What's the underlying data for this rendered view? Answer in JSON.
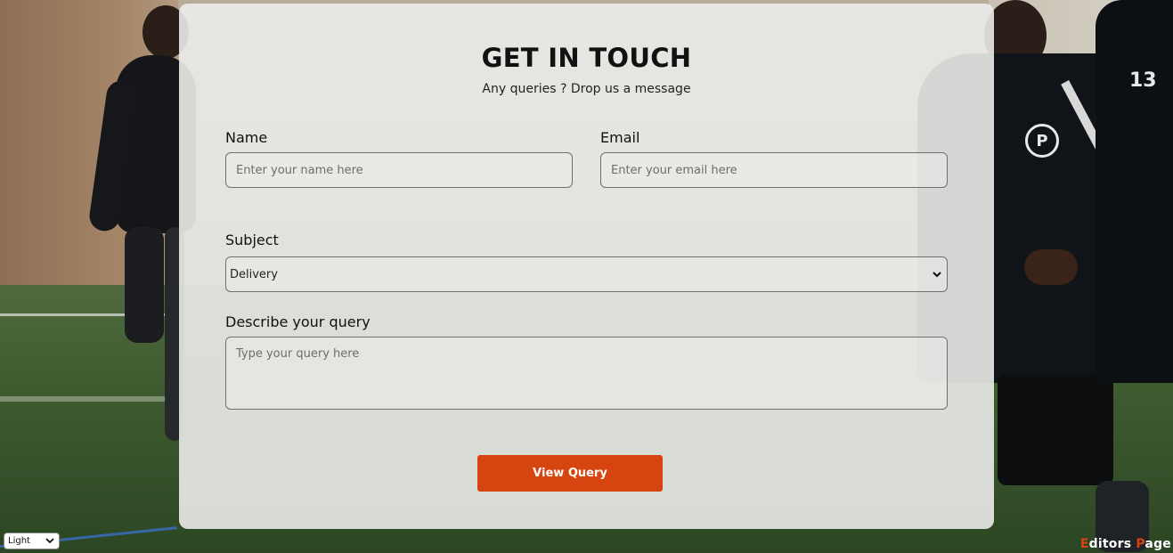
{
  "form": {
    "title": "GET IN TOUCH",
    "subtitle": "Any queries ? Drop us a message",
    "name": {
      "label": "Name",
      "placeholder": "Enter your name here",
      "value": ""
    },
    "email": {
      "label": "Email",
      "placeholder": "Enter your email here",
      "value": ""
    },
    "subject": {
      "label": "Subject",
      "selected": "Delivery"
    },
    "query": {
      "label": "Describe your query",
      "placeholder": "Type your query here",
      "value": ""
    },
    "submit_label": "View Query"
  },
  "theme_select": {
    "selected": "Light"
  },
  "watermark": {
    "first_letter": "E",
    "rest_first": "ditors ",
    "second_letter": "P",
    "rest_second": "age"
  },
  "background": {
    "jersey_number": "13",
    "crest_letter": "P"
  },
  "colors": {
    "accent": "#d6440f",
    "card_background": "#ececea",
    "text": "#111111"
  },
  "icons": {
    "subject_dropdown": "chevron-down-icon",
    "theme_dropdown": "chevron-down-icon"
  }
}
